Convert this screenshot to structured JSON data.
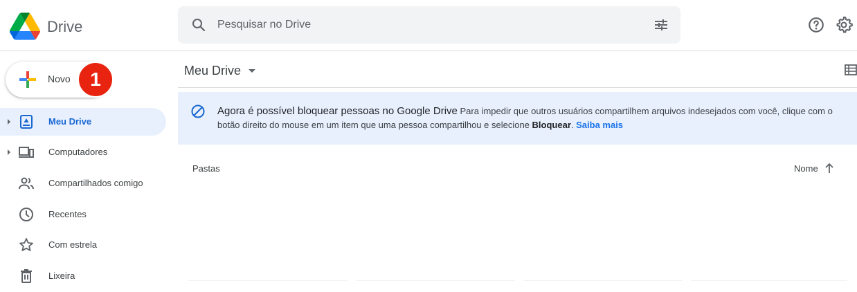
{
  "header": {
    "app_name": "Drive",
    "search": {
      "placeholder": "Pesquisar no Drive",
      "value": ""
    },
    "icons": [
      "drive-logo",
      "search-icon",
      "tune-icon",
      "help-icon",
      "settings-icon"
    ]
  },
  "sidebar": {
    "new_button_label": "Novo",
    "step_badge": "1",
    "items": [
      {
        "label": "Meu Drive",
        "icon": "my-drive-icon",
        "active": true,
        "expandable": true
      },
      {
        "label": "Computadores",
        "icon": "computers-icon",
        "active": false,
        "expandable": true
      },
      {
        "label": "Compartilhados comigo",
        "icon": "shared-icon",
        "active": false,
        "expandable": false
      },
      {
        "label": "Recentes",
        "icon": "clock-icon",
        "active": false,
        "expandable": false
      },
      {
        "label": "Com estrela",
        "icon": "star-icon",
        "active": false,
        "expandable": false
      },
      {
        "label": "Lixeira",
        "icon": "trash-icon",
        "active": false,
        "expandable": false
      }
    ]
  },
  "main": {
    "title": "Meu Drive",
    "banner": {
      "title": "Agora é possível bloquear pessoas no Google Drive",
      "text_before": "Para impedir que outros usuários compartilhem arquivos indesejados com você, clique com o botão direito do mouse em um item que uma pessoa compartilhou e selecione ",
      "bold": "Bloquear",
      "text_after": ". ",
      "link": "Saiba mais"
    },
    "section_label": "Pastas",
    "sort_label": "Nome"
  },
  "colors": {
    "accent": "#1967d2",
    "active_bg": "#e8f0fe",
    "banner_bg": "#e8f0fe",
    "link": "#1a73e8",
    "badge": "#e8230f"
  }
}
